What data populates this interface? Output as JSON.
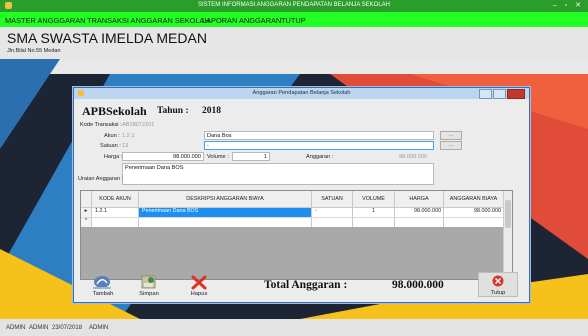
{
  "window": {
    "title": "SISTEM INFORMASI ANGGARAN PENDAPATAN BELANJA SEKOLAH",
    "controls": "– ▫ ✕"
  },
  "menu": [
    {
      "label": "MASTER ANGGGARAN"
    },
    {
      "label": "TRANSAKSI ANGGARAN SEKOLAH"
    },
    {
      "label": "LAPORAN ANGGARAN"
    },
    {
      "label": "TUTUP"
    }
  ],
  "school": {
    "name": "SMA SWASTA IMELDA MEDAN",
    "address": "Jln.Bilal No.55 Medan"
  },
  "dialog": {
    "title": "Anggaran Pendapatan Belanja Sekolah",
    "heading": "APBSekolah",
    "tahun_label": "Tahun :",
    "tahun_value": "2018",
    "kode_transaksi_label": "Kode Transaksi :",
    "kode_transaksi_value": "AB18072201",
    "akun_label": "Akun :",
    "akun_value": "1.2.1",
    "akun_name": "Dana Bos",
    "satuan_label": "Satuan :",
    "satuan_value": "13",
    "satuan_input": "-",
    "lookup_label": "...",
    "harga_label": "Harga :",
    "harga_value": "98.000.000",
    "volume_label": "Volume :",
    "volume_value": "1",
    "anggaran_label": "Anggaran :",
    "anggaran_value": "98.000.000",
    "uraian_label": "Uraian Anggaran :",
    "uraian_value": "Penerimaan Dana BOS",
    "table": {
      "headers": [
        "KODE AKUN",
        "DESKRIPSI ANGGARAN BIAYA",
        "SATUAN",
        "VOLUME",
        "HARGA",
        "ANGGARAN BIAYA"
      ],
      "rows": [
        {
          "marker": "▸",
          "kode": "1.2.1",
          "deskripsi": "Penerimaan Dana BOS",
          "satuan": "-",
          "volume": "1",
          "harga": "98.000.000",
          "anggaran": "98.000.000"
        }
      ],
      "new_row_marker": "*"
    },
    "buttons": {
      "tambah": "Tambah",
      "simpan": "Simpan",
      "hapus": "Hapus",
      "tutup": "Tutup"
    },
    "total_label": "Total Anggaran :",
    "total_value": "98.000.000"
  },
  "status": {
    "user1": "ADMIN",
    "user2": "ADMIN",
    "date": "23/07/2018",
    "user3": "ADMIN"
  },
  "colors": {
    "titlebar": "#2a9d2a",
    "menubar": "#22ff22",
    "selected_row": "#1f8ef1",
    "bg_dark": "#1d2433",
    "bg_red": "#e14b3a",
    "bg_blue": "#2d7fc1",
    "bg_yellow": "#f6c11b"
  }
}
